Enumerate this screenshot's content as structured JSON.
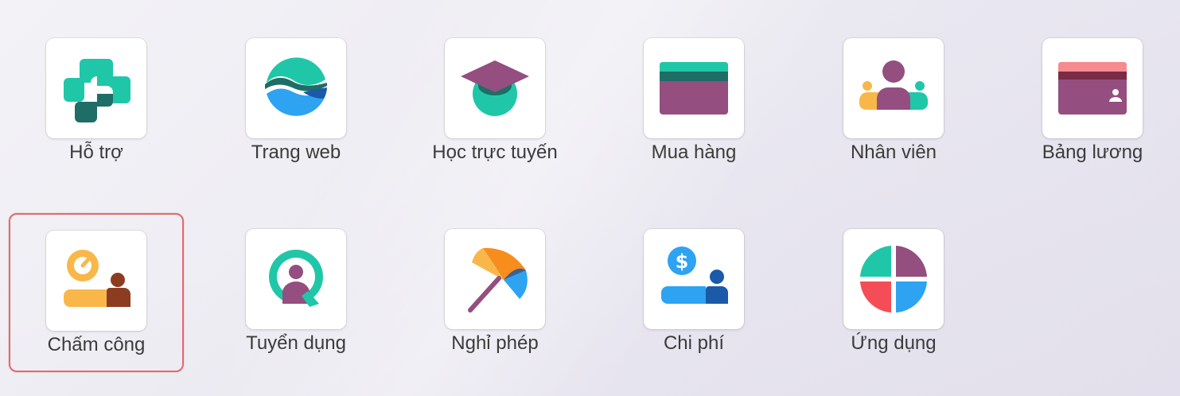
{
  "apps": [
    {
      "label": "Hỗ trợ",
      "icon": "helpdesk-icon"
    },
    {
      "label": "Trang web",
      "icon": "website-icon"
    },
    {
      "label": "Học trực tuyến",
      "icon": "elearning-icon"
    },
    {
      "label": "Mua hàng",
      "icon": "purchase-icon"
    },
    {
      "label": "Nhân viên",
      "icon": "employees-icon"
    },
    {
      "label": "Bảng lương",
      "icon": "payroll-icon"
    },
    {
      "label": "Chấm công",
      "icon": "attendances-icon",
      "selected": true
    },
    {
      "label": "Tuyển dụng",
      "icon": "recruitment-icon"
    },
    {
      "label": "Nghỉ phép",
      "icon": "time-off-icon"
    },
    {
      "label": "Chi phí",
      "icon": "expenses-icon"
    },
    {
      "label": "Ứng dụng",
      "icon": "apps-icon"
    }
  ],
  "colors": {
    "teal": "#1fc7a8",
    "dark_teal": "#1e6d66",
    "purple": "#944e7f",
    "blue": "#2da3f2",
    "navy": "#1a5aa8",
    "yellow": "#f9b74a",
    "brown": "#8c3d21",
    "red": "#f44d56",
    "pink": "#f58b8f",
    "orange": "#f68d1d",
    "selection_border": "#e06b6b"
  }
}
